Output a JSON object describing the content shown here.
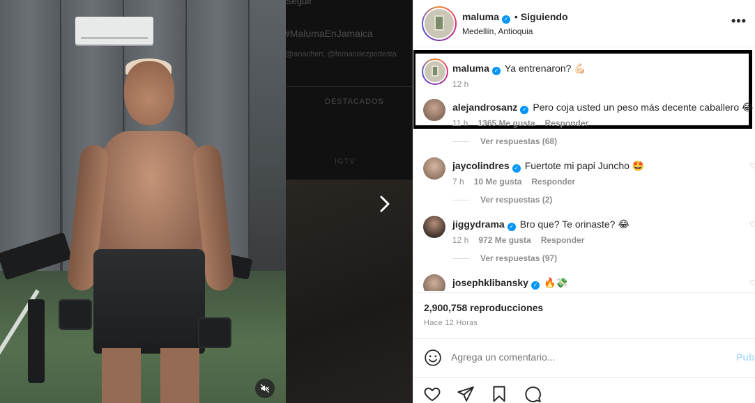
{
  "backdrop": {
    "top_text": "Seguir",
    "hashtag": "#MalumaEnJamaica",
    "tags": "@anacheri, @fernandezpodesta",
    "tab_highlights": "DESTACADOS",
    "tab_igtv": "IGTV"
  },
  "post": {
    "author": "maluma",
    "following_label": "Siguiendo",
    "location": "Medellín, Antioquia",
    "more_icon": "more-horizontal-icon"
  },
  "comments": [
    {
      "user": "maluma",
      "text": "Ya entrenaron? 💪🏻",
      "time": "12 h",
      "likes": "",
      "reply": ""
    },
    {
      "user": "alejandrosanz",
      "text": "Pero coja usted un peso más decente caballero 😂",
      "time": "11 h",
      "likes": "1365 Me gusta",
      "reply": "Responder"
    },
    {
      "user": "jaycolindres",
      "text": "Fuertote mi papi Juncho 🤩",
      "time": "7 h",
      "likes": "10 Me gusta",
      "reply": "Responder"
    },
    {
      "user": "jiggydrama",
      "text": "Bro que? Te orinaste? 😂",
      "time": "12 h",
      "likes": "972 Me gusta",
      "reply": "Responder"
    },
    {
      "user": "josephklibansky",
      "text": "🔥💸",
      "time": "",
      "likes": "",
      "reply": ""
    }
  ],
  "replies": [
    "Ver respuestas (68)",
    "Ver respuestas (2)",
    "Ver respuestas (97)"
  ],
  "stats": {
    "views": "2,900,758 reproducciones",
    "posted": "Hace 12 Horas"
  },
  "composer": {
    "placeholder": "Agrega un comentario...",
    "post_label": "Publicar"
  },
  "colors": {
    "accent": "#0095f6",
    "muted": "#8e8e8e",
    "text": "#262626"
  }
}
